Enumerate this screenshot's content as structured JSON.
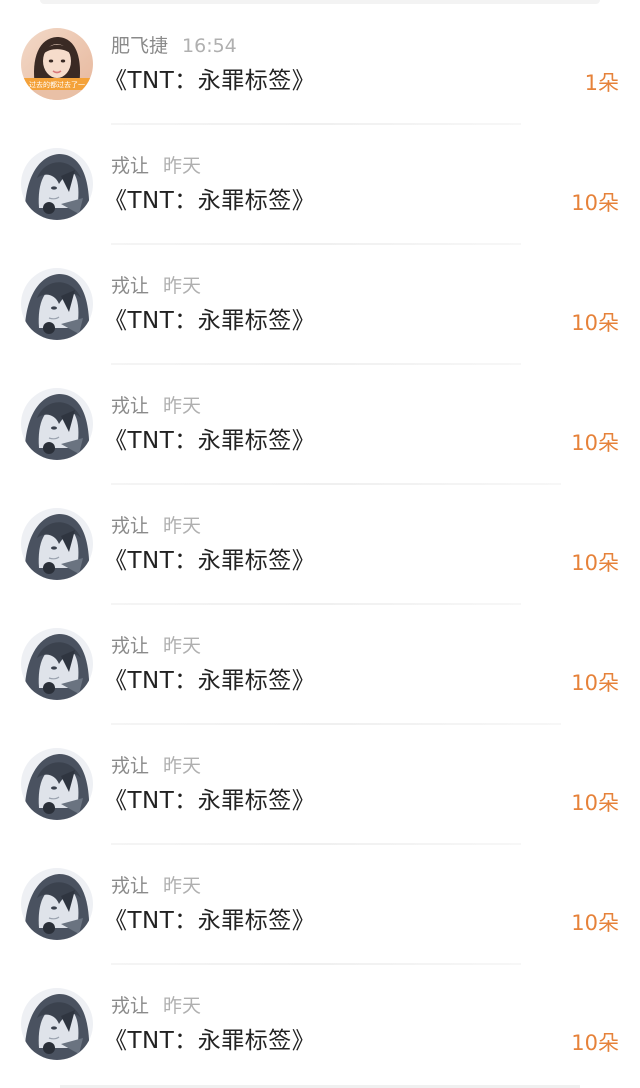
{
  "colors": {
    "accent": "#e6823a",
    "name": "#8a8a8a",
    "time": "#b0b0b0",
    "title": "#222222"
  },
  "gifts": [
    {
      "sender": "肥飞捷",
      "time": "16:54",
      "title": "《TNT：永罪标签》",
      "count": "1朵",
      "avatar_icon": "girl-photo-avatar-icon",
      "avatar_caption": "过去的都过去了一"
    },
    {
      "sender": "戎让",
      "time": "昨天",
      "title": "《TNT：永罪标签》",
      "count": "10朵",
      "avatar_icon": "anime-boy-avatar-icon"
    },
    {
      "sender": "戎让",
      "time": "昨天",
      "title": "《TNT：永罪标签》",
      "count": "10朵",
      "avatar_icon": "anime-boy-avatar-icon"
    },
    {
      "sender": "戎让",
      "time": "昨天",
      "title": "《TNT：永罪标签》",
      "count": "10朵",
      "avatar_icon": "anime-boy-avatar-icon"
    },
    {
      "sender": "戎让",
      "time": "昨天",
      "title": "《TNT：永罪标签》",
      "count": "10朵",
      "avatar_icon": "anime-boy-avatar-icon"
    },
    {
      "sender": "戎让",
      "time": "昨天",
      "title": "《TNT：永罪标签》",
      "count": "10朵",
      "avatar_icon": "anime-boy-avatar-icon"
    },
    {
      "sender": "戎让",
      "time": "昨天",
      "title": "《TNT：永罪标签》",
      "count": "10朵",
      "avatar_icon": "anime-boy-avatar-icon"
    },
    {
      "sender": "戎让",
      "time": "昨天",
      "title": "《TNT：永罪标签》",
      "count": "10朵",
      "avatar_icon": "anime-boy-avatar-icon"
    },
    {
      "sender": "戎让",
      "time": "昨天",
      "title": "《TNT：永罪标签》",
      "count": "10朵",
      "avatar_icon": "anime-boy-avatar-icon"
    }
  ]
}
